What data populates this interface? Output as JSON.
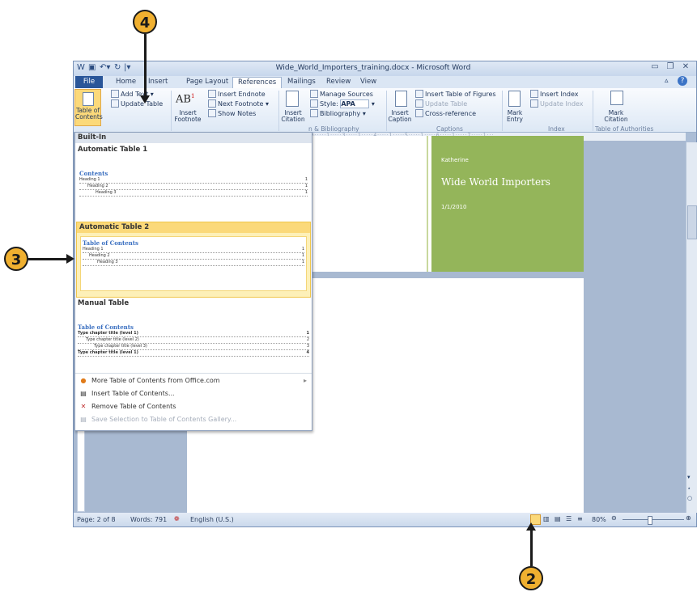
{
  "window": {
    "title": "Wide_World_Importers_training.docx - Microsoft Word"
  },
  "tabs": [
    "File",
    "Home",
    "Insert",
    "Page Layout",
    "References",
    "Mailings",
    "Review",
    "View"
  ],
  "ribbon": {
    "add_text": "Add Text",
    "update_table": "Update Table",
    "toc_button": "Table of Contents",
    "ab_glyph": "AB",
    "insert_footnote": "Insert Footnote",
    "insert_endnote": "Insert Endnote",
    "next_footnote": "Next Footnote",
    "show_notes": "Show Notes",
    "insert_citation": "Insert Citation",
    "manage_sources": "Manage Sources",
    "style_label": "Style:",
    "style_value": "APA",
    "bibliography": "Bibliography",
    "citations_group": "n & Bibliography",
    "insert_caption": "Insert Caption",
    "insert_table_of_figures": "Insert Table of Figures",
    "update_table_captions": "Update Table",
    "cross_reference": "Cross-reference",
    "captions_group": "Captions",
    "mark_entry": "Mark Entry",
    "insert_index": "Insert Index",
    "update_index": "Update Index",
    "index_group": "Index",
    "mark_citation": "Mark Citation",
    "authorities_group": "Table of Authorities"
  },
  "cover": {
    "author": "Katherine",
    "company": "Wide World Importers",
    "date": "1/1/2010"
  },
  "dropdown": {
    "built_in": "Built-In",
    "auto1": {
      "title": "Automatic Table 1",
      "heading": "Contents",
      "rows": [
        "Heading 1",
        "Heading 2",
        "Heading 3"
      ]
    },
    "auto2": {
      "title": "Automatic Table 2",
      "heading": "Table of Contents",
      "rows": [
        "Heading 1",
        "Heading 2",
        "Heading 3"
      ]
    },
    "manual": {
      "title": "Manual Table",
      "heading": "Table of Contents",
      "rows": [
        "Type chapter title (level 1)",
        "Type chapter title (level 2)",
        "Type chapter title (level 3)",
        "Type chapter title (level 1)"
      ],
      "page_nums": [
        "1",
        "2",
        "3",
        "4"
      ]
    },
    "page_num": "1",
    "menu": [
      "More Table of Contents from Office.com",
      "Insert Table of Contents...",
      "Remove Table of Contents",
      "Save Selection to Table of Contents Gallery..."
    ]
  },
  "status": {
    "page": "Page: 2 of 8",
    "words": "Words: 791",
    "language": "English (U.S.)",
    "zoom": "80%"
  },
  "callouts": [
    "4",
    "3",
    "2"
  ]
}
